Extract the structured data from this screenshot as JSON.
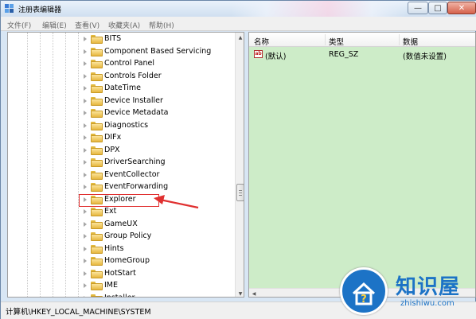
{
  "window": {
    "title": "注册表编辑器",
    "min_symbol": "—",
    "max_symbol": "□",
    "close_symbol": "✕"
  },
  "menu": [
    {
      "label": "文件(F)"
    },
    {
      "label": "编辑(E)"
    },
    {
      "label": "查看(V)"
    },
    {
      "label": "收藏夹(A)"
    },
    {
      "label": "帮助(H)"
    }
  ],
  "tree": {
    "items": [
      {
        "label": "BITS"
      },
      {
        "label": "Component Based Servicing"
      },
      {
        "label": "Control Panel"
      },
      {
        "label": "Controls Folder"
      },
      {
        "label": "DateTime"
      },
      {
        "label": "Device Installer"
      },
      {
        "label": "Device Metadata"
      },
      {
        "label": "Diagnostics"
      },
      {
        "label": "DIFx"
      },
      {
        "label": "DPX"
      },
      {
        "label": "DriverSearching"
      },
      {
        "label": "EventCollector"
      },
      {
        "label": "EventForwarding"
      },
      {
        "label": "Explorer",
        "highlighted": true
      },
      {
        "label": "Ext"
      },
      {
        "label": "GameUX"
      },
      {
        "label": "Group Policy"
      },
      {
        "label": "Hints"
      },
      {
        "label": "HomeGroup"
      },
      {
        "label": "HotStart"
      },
      {
        "label": "IME"
      },
      {
        "label": "Installer"
      }
    ]
  },
  "values": {
    "headers": {
      "name": "名称",
      "type": "类型",
      "data": "数据"
    },
    "rows": [
      {
        "icon": "ab-string-icon",
        "icon_text": "ab",
        "name": "(默认)",
        "type": "REG_SZ",
        "data": "(数值未设置)"
      }
    ],
    "background": "#cdecc8"
  },
  "status": {
    "path": "计算机\\HKEY_LOCAL_MACHINE\\SYSTEM"
  },
  "watermark": {
    "main": "知识屋",
    "sub": "zhishiwu.com",
    "color": "#1c73c6"
  },
  "annotation": {
    "box_color": "#e03030",
    "arrow_color": "#e03030"
  }
}
